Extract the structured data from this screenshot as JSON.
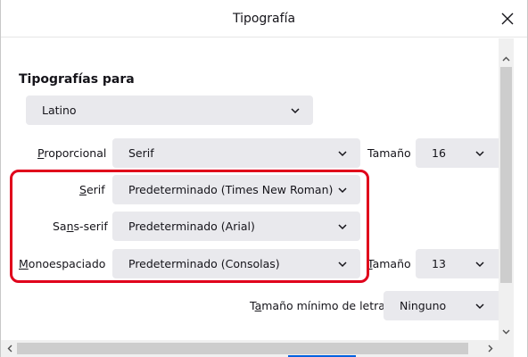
{
  "window": {
    "title": "Tipografía"
  },
  "section": {
    "heading": "Tipografías para",
    "language_value": "Latino"
  },
  "rows": {
    "proportional": {
      "label_pre": "",
      "label_key": "P",
      "label_post": "roporcional",
      "value": "Serif",
      "size_label_pre": "Tamaño",
      "size_label_key": "",
      "size_label_post": "",
      "size_value": "16"
    },
    "serif": {
      "label_pre": "",
      "label_key": "S",
      "label_post": "erif",
      "value": "Predeterminado (Times New Roman)"
    },
    "sans": {
      "label_pre": "Sa",
      "label_key": "n",
      "label_post": "s-serif",
      "value": "Predeterminado (Arial)"
    },
    "mono": {
      "label_pre": "",
      "label_key": "M",
      "label_post": "onoespaciado",
      "value": "Predeterminado (Consolas)",
      "size_label_pre": "",
      "size_label_key": "T",
      "size_label_post": "amaño",
      "size_value": "13"
    },
    "minimum": {
      "label_pre": "T",
      "label_key": "a",
      "label_post": "maño mínimo de letra",
      "value": "Ninguno"
    }
  },
  "icons": {
    "close": "close-icon",
    "chevron": "chevron-down-icon",
    "scroll_up": "scroll-up-arrow-icon",
    "scroll_down": "scroll-down-arrow-icon",
    "scroll_left": "scroll-left-arrow-icon",
    "scroll_right": "scroll-right-arrow-icon"
  },
  "colors": {
    "highlight": "#e0001b",
    "dropdown_bg": "#e9e9ed",
    "text": "#15141a"
  }
}
